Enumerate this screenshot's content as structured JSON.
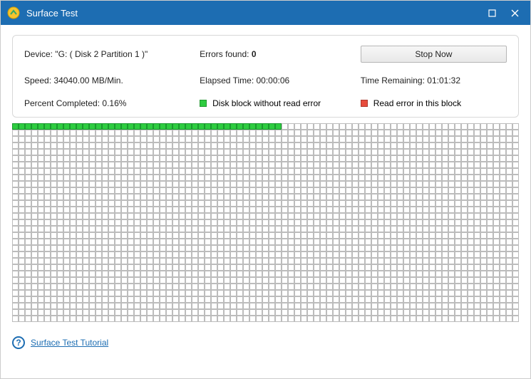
{
  "window": {
    "title": "Surface Test"
  },
  "info": {
    "device_label": "Device:",
    "device_value": "\"G: ( Disk 2 Partition 1 )\"",
    "errors_label": "Errors found:",
    "errors_value": "0",
    "stop_label": "Stop Now",
    "speed_label": "Speed:",
    "speed_value": "34040.00 MB/Min.",
    "elapsed_label": "Elapsed Time:",
    "elapsed_value": "00:00:06",
    "remaining_label": "Time Remaining:",
    "remaining_value": "01:01:32",
    "percent_label": "Percent Completed:",
    "percent_value": "0.16%",
    "legend_ok": "Disk block without read error",
    "legend_err": "Read error in this block"
  },
  "grid": {
    "cols": 79,
    "rows": 31,
    "ok_count": 42
  },
  "footer": {
    "tutorial": "Surface Test Tutorial"
  },
  "colors": {
    "accent": "#1d6db2",
    "ok": "#2ecc40",
    "err": "#e74c3c"
  }
}
